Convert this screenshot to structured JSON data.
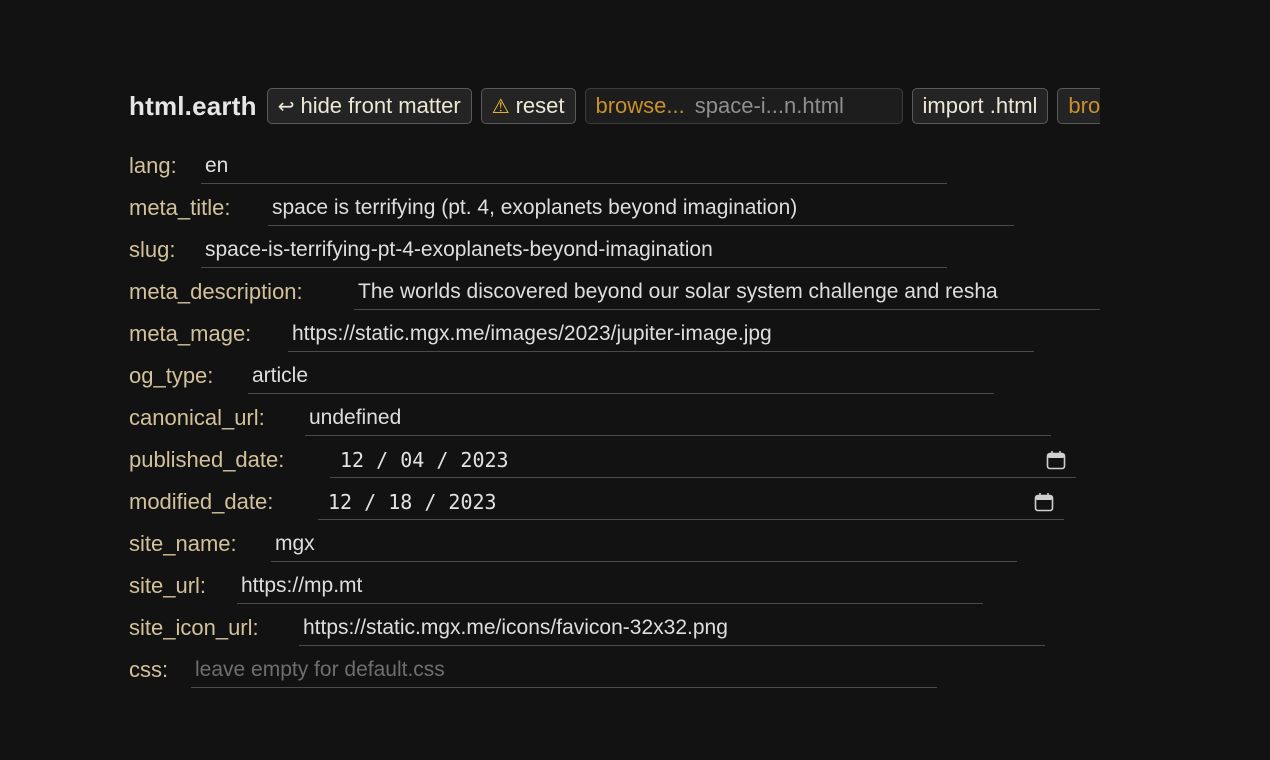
{
  "toolbar": {
    "brand": "html.earth",
    "hide_front_matter_label": "hide front matter",
    "reset_label": "reset",
    "browse_label": "browse...",
    "file_name": "space-i...n.html",
    "import_label": "import .html",
    "partial_button_label": "bro"
  },
  "fields": {
    "lang": {
      "label": "lang:",
      "value": "en"
    },
    "meta_title": {
      "label": "meta_title:",
      "value": "space is terrifying (pt. 4, exoplanets beyond imagination)"
    },
    "slug": {
      "label": "slug:",
      "value": "space-is-terrifying-pt-4-exoplanets-beyond-imagination"
    },
    "meta_description": {
      "label": "meta_description:",
      "value": "The worlds discovered beyond our solar system challenge and resha"
    },
    "meta_mage": {
      "label": "meta_mage:",
      "value": "https://static.mgx.me/images/2023/jupiter-image.jpg"
    },
    "og_type": {
      "label": "og_type:",
      "value": "article"
    },
    "canonical_url": {
      "label": "canonical_url:",
      "value": "undefined"
    },
    "published_date": {
      "label": "published_date:",
      "value": "12 / 04 / 2023"
    },
    "modified_date": {
      "label": "modified_date:",
      "value": "12 / 18 / 2023"
    },
    "site_name": {
      "label": "site_name:",
      "value": "mgx"
    },
    "site_url": {
      "label": "site_url:",
      "value": "https://mp.mt"
    },
    "site_icon_url": {
      "label": "site_icon_url:",
      "value": "https://static.mgx.me/icons/favicon-32x32.png"
    },
    "css": {
      "label": "css:",
      "placeholder": "leave empty for default.css"
    }
  },
  "icons": {
    "return": "return-arrow-icon",
    "warning": "warning-icon",
    "calendar": "calendar-icon"
  },
  "colors": {
    "background": "#121212",
    "label": "#d2c19a",
    "accent": "#c8902c",
    "warning": "#f2c230"
  }
}
